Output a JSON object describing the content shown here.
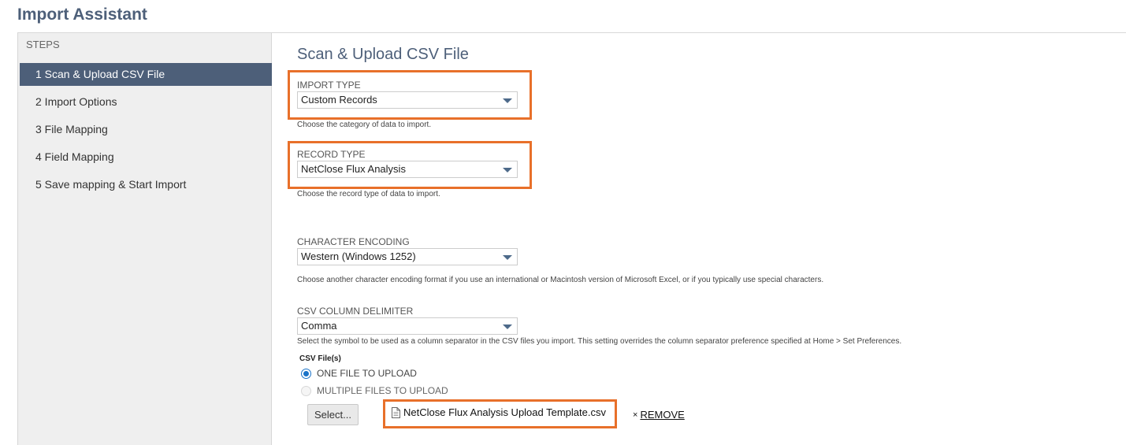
{
  "app": {
    "title": "Import Assistant"
  },
  "sidebar": {
    "heading": "STEPS",
    "steps": [
      {
        "label": "1 Scan & Upload CSV File",
        "active": true
      },
      {
        "label": "2 Import Options",
        "active": false
      },
      {
        "label": "3 File Mapping",
        "active": false
      },
      {
        "label": "4 Field Mapping",
        "active": false
      },
      {
        "label": "5 Save mapping & Start Import",
        "active": false
      }
    ]
  },
  "main": {
    "title": "Scan & Upload CSV File",
    "import_type": {
      "label": "IMPORT TYPE",
      "value": "Custom Records",
      "help": "Choose the category of data to import."
    },
    "record_type": {
      "label": "RECORD TYPE",
      "value": "NetClose Flux Analysis",
      "help": "Choose the record type of data to import."
    },
    "character_encoding": {
      "label": "CHARACTER ENCODING",
      "value": "Western (Windows 1252)",
      "help": "Choose another character encoding format if you use an international or Macintosh version of Microsoft Excel, or if you typically use special characters."
    },
    "csv_delimiter": {
      "label": "CSV COLUMN DELIMITER",
      "value": "Comma",
      "help": "Select the symbol to be used as a column separator in the CSV files you import. This setting overrides the column separator preference specified at Home > Set Preferences."
    },
    "csv_files": {
      "label": "CSV File(s)",
      "options": [
        {
          "label": "ONE FILE TO UPLOAD",
          "checked": true
        },
        {
          "label": "MULTIPLE FILES TO UPLOAD",
          "checked": false
        }
      ],
      "select_button": "Select...",
      "file_name": "NetClose Flux Analysis Upload Template.csv",
      "remove_label": "REMOVE"
    }
  },
  "colors": {
    "accent": "#4d5f79",
    "highlight": "#e8702a",
    "radio": "#1a73c8"
  },
  "icons": [
    "chevron-down-icon",
    "document-icon",
    "close-icon"
  ]
}
